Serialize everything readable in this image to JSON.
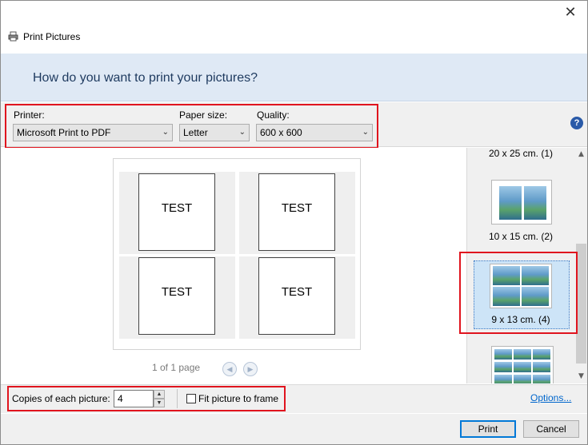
{
  "window": {
    "title": "Print Pictures",
    "close_glyph": "✕"
  },
  "header": {
    "question": "How do you want to print your pictures?"
  },
  "printer_options": {
    "printer_label": "Printer:",
    "printer_value": "Microsoft Print to PDF",
    "paper_size_label": "Paper size:",
    "paper_size_value": "Letter",
    "quality_label": "Quality:",
    "quality_value": "600 x 600",
    "help_glyph": "?"
  },
  "preview": {
    "pictures": [
      "TEST",
      "TEST",
      "TEST",
      "TEST"
    ],
    "pager_text": "1 of 1 page",
    "prev_glyph": "◀",
    "next_glyph": "▶"
  },
  "layouts": {
    "items": [
      {
        "label": "20 x 25 cm. (1)"
      },
      {
        "label": "10 x 15 cm. (2)"
      },
      {
        "label": "9 x 13 cm. (4)",
        "selected": true
      },
      {
        "label": ""
      }
    ],
    "scroll_up_glyph": "▲",
    "scroll_down_glyph": "▼"
  },
  "copies": {
    "label": "Copies of each picture:",
    "value": "4",
    "fit_label": "Fit picture to frame",
    "fit_checked": false,
    "options_link": "Options..."
  },
  "footer": {
    "print_label": "Print",
    "cancel_label": "Cancel"
  },
  "colors": {
    "highlight_box": "#e0141e",
    "header_band": "#dfe9f5",
    "link": "#0066cc"
  }
}
